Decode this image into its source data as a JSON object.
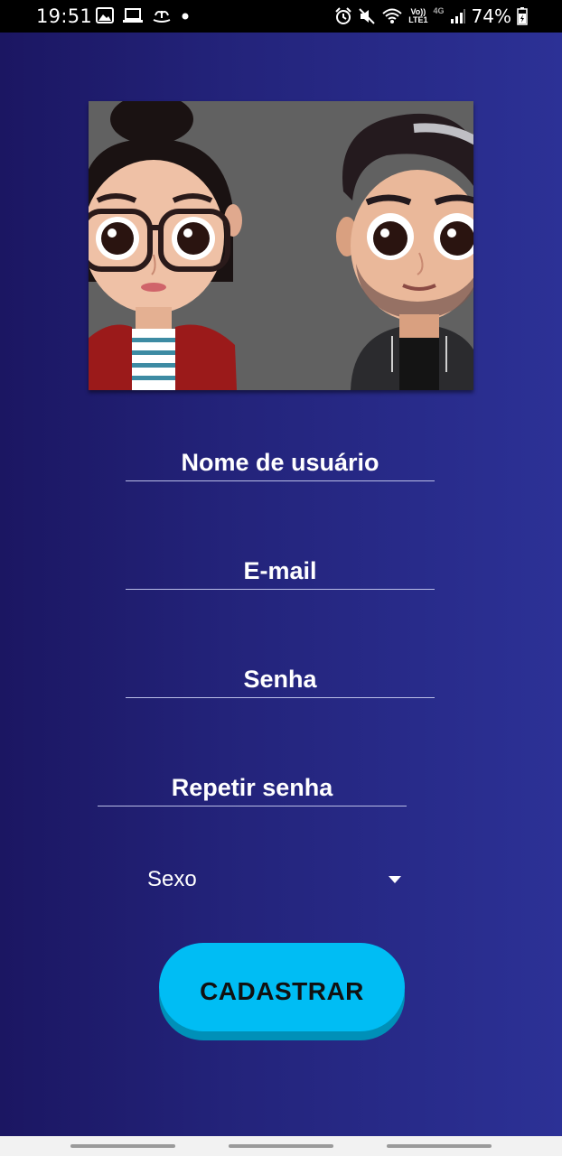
{
  "status_bar": {
    "time": "19:51",
    "battery": "74%",
    "network_top": "Vo))",
    "network_bottom": "LTE1",
    "network_type": "4G",
    "left_icons": [
      "image-icon",
      "laptop-icon",
      "fountain-icon",
      "dot-icon"
    ],
    "right_icons": [
      "alarm-icon",
      "mute-icon",
      "wifi-icon",
      "signal-icon",
      "battery-icon"
    ]
  },
  "form": {
    "username_placeholder": "Nome de usuário",
    "email_placeholder": "E-mail",
    "password_placeholder": "Senha",
    "repeat_password_placeholder": "Repetir senha",
    "gender_select": "Sexo",
    "submit_label": "CADASTRAR"
  },
  "colors": {
    "background_start": "#1b1662",
    "background_end": "#2c3196",
    "button": "#00bdf4",
    "card": "#616161"
  }
}
